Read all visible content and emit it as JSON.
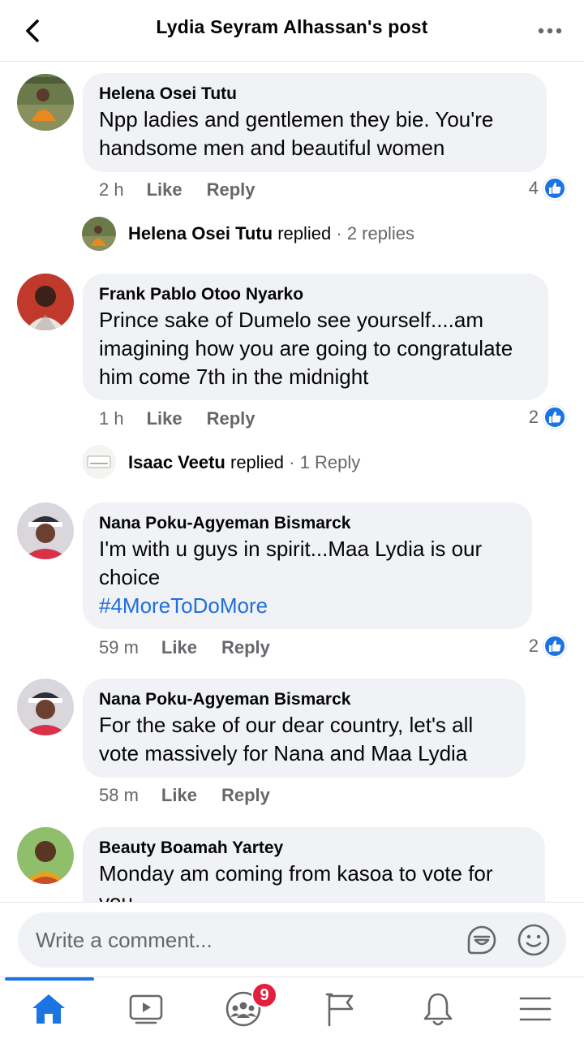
{
  "header": {
    "title": "Lydia Seyram Alhassan's post",
    "back_icon": "chevron-left-icon",
    "more_icon": "more-horizontal-icon"
  },
  "actions": {
    "like": "Like",
    "reply": "Reply"
  },
  "comments": [
    {
      "author": "Helena Osei Tutu",
      "text": "Npp ladies and gentlemen they bie. You're handsome men and beautiful women",
      "time": "2 h",
      "reactions": "4",
      "replies": {
        "name": "Helena Osei Tutu",
        "verb": "replied",
        "count": "· 2 replies"
      }
    },
    {
      "author": "Frank Pablo Otoo Nyarko",
      "text": "Prince sake of Dumelo see yourself....am imagining how you are going to congratulate him come 7th in the midnight",
      "time": "1 h",
      "reactions": "2",
      "replies": {
        "name": "Isaac Veetu",
        "verb": "replied",
        "count": "· 1 Reply"
      }
    },
    {
      "author": "Nana Poku-Agyeman Bismarck",
      "text": "I'm with u guys in spirit...Maa Lydia is our choice",
      "hashtag": "#4MoreToDoMore",
      "time": "59 m",
      "reactions": "2"
    },
    {
      "author": "Nana Poku-Agyeman Bismarck",
      "text": "For the sake of our dear country, let's all vote massively for Nana and Maa Lydia",
      "time": "58 m"
    },
    {
      "author": "Beauty Boamah Yartey",
      "text": "Monday am coming from kasoa to vote for you"
    }
  ],
  "composer": {
    "placeholder": "Write a comment..."
  },
  "tabbar": {
    "items": [
      "home-icon",
      "video-icon",
      "groups-icon",
      "pages-flag-icon",
      "notifications-bell-icon",
      "menu-icon"
    ],
    "groups_badge": "9"
  },
  "colors": {
    "accent": "#1b74e4",
    "bubble": "#f0f2f5",
    "muted": "#65676b",
    "hashtag": "#216fdb",
    "badge": "#e41e3f"
  }
}
